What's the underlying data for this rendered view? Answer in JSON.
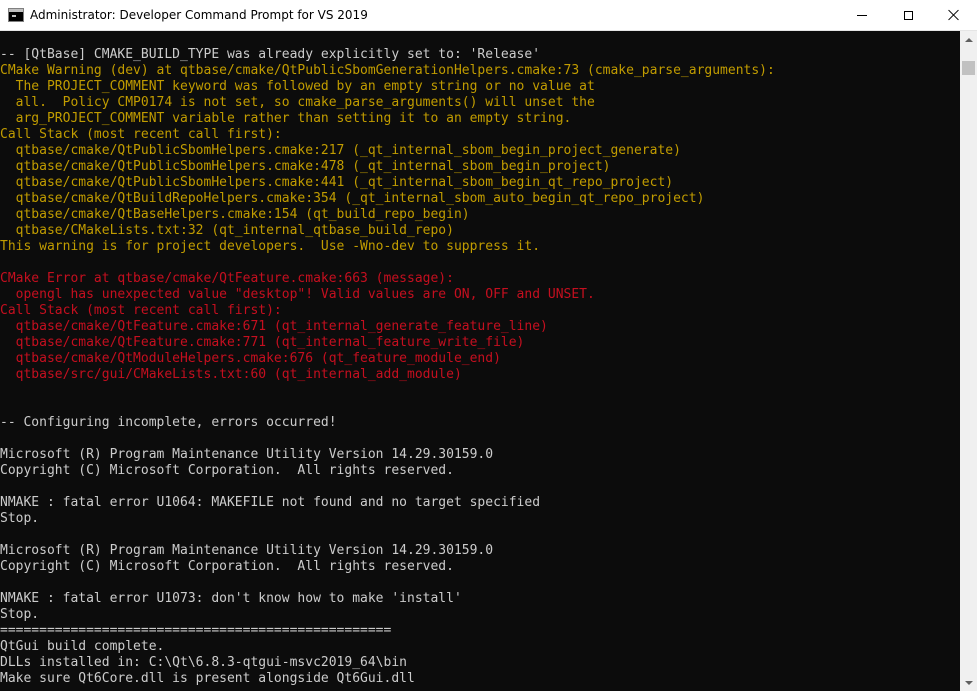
{
  "window": {
    "title": "Administrator: Developer Command Prompt for VS 2019",
    "icon": "console-icon",
    "controls": [
      "minimize-icon",
      "maximize-icon",
      "close-icon"
    ]
  },
  "colors": {
    "normal": "#cccccc",
    "warning": "#c19c00",
    "error": "#c50f1f",
    "background": "#0c0c0c"
  },
  "console": {
    "lines": [
      {
        "text": "-- [QtBase] CMAKE_BUILD_TYPE was already explicitly set to: 'Release'",
        "kind": "normal"
      },
      {
        "text": "CMake Warning (dev) at qtbase/cmake/QtPublicSbomGenerationHelpers.cmake:73 (cmake_parse_arguments):",
        "kind": "warn"
      },
      {
        "text": "  The PROJECT_COMMENT keyword was followed by an empty string or no value at",
        "kind": "warn"
      },
      {
        "text": "  all.  Policy CMP0174 is not set, so cmake_parse_arguments() will unset the",
        "kind": "warn"
      },
      {
        "text": "  arg_PROJECT_COMMENT variable rather than setting it to an empty string.",
        "kind": "warn"
      },
      {
        "text": "Call Stack (most recent call first):",
        "kind": "warn"
      },
      {
        "text": "  qtbase/cmake/QtPublicSbomHelpers.cmake:217 (_qt_internal_sbom_begin_project_generate)",
        "kind": "warn"
      },
      {
        "text": "  qtbase/cmake/QtPublicSbomHelpers.cmake:478 (_qt_internal_sbom_begin_project)",
        "kind": "warn"
      },
      {
        "text": "  qtbase/cmake/QtPublicSbomHelpers.cmake:441 (_qt_internal_sbom_begin_qt_repo_project)",
        "kind": "warn"
      },
      {
        "text": "  qtbase/cmake/QtBuildRepoHelpers.cmake:354 (_qt_internal_sbom_auto_begin_qt_repo_project)",
        "kind": "warn"
      },
      {
        "text": "  qtbase/cmake/QtBaseHelpers.cmake:154 (qt_build_repo_begin)",
        "kind": "warn"
      },
      {
        "text": "  qtbase/CMakeLists.txt:32 (qt_internal_qtbase_build_repo)",
        "kind": "warn"
      },
      {
        "text": "This warning is for project developers.  Use -Wno-dev to suppress it.",
        "kind": "warn"
      },
      {
        "text": "",
        "kind": "normal"
      },
      {
        "text": "CMake Error at qtbase/cmake/QtFeature.cmake:663 (message):",
        "kind": "error"
      },
      {
        "text": "  opengl has unexpected value \"desktop\"! Valid values are ON, OFF and UNSET.",
        "kind": "error"
      },
      {
        "text": "Call Stack (most recent call first):",
        "kind": "error"
      },
      {
        "text": "  qtbase/cmake/QtFeature.cmake:671 (qt_internal_generate_feature_line)",
        "kind": "error"
      },
      {
        "text": "  qtbase/cmake/QtFeature.cmake:771 (qt_internal_feature_write_file)",
        "kind": "error"
      },
      {
        "text": "  qtbase/cmake/QtModuleHelpers.cmake:676 (qt_feature_module_end)",
        "kind": "error"
      },
      {
        "text": "  qtbase/src/gui/CMakeLists.txt:60 (qt_internal_add_module)",
        "kind": "error"
      },
      {
        "text": "",
        "kind": "normal"
      },
      {
        "text": "",
        "kind": "normal"
      },
      {
        "text": "-- Configuring incomplete, errors occurred!",
        "kind": "normal"
      },
      {
        "text": "",
        "kind": "normal"
      },
      {
        "text": "Microsoft (R) Program Maintenance Utility Version 14.29.30159.0",
        "kind": "normal"
      },
      {
        "text": "Copyright (C) Microsoft Corporation.  All rights reserved.",
        "kind": "normal"
      },
      {
        "text": "",
        "kind": "normal"
      },
      {
        "text": "NMAKE : fatal error U1064: MAKEFILE not found and no target specified",
        "kind": "normal"
      },
      {
        "text": "Stop.",
        "kind": "normal"
      },
      {
        "text": "",
        "kind": "normal"
      },
      {
        "text": "Microsoft (R) Program Maintenance Utility Version 14.29.30159.0",
        "kind": "normal"
      },
      {
        "text": "Copyright (C) Microsoft Corporation.  All rights reserved.",
        "kind": "normal"
      },
      {
        "text": "",
        "kind": "normal"
      },
      {
        "text": "NMAKE : fatal error U1073: don't know how to make 'install'",
        "kind": "normal"
      },
      {
        "text": "Stop.",
        "kind": "normal"
      },
      {
        "text": "==================================================",
        "kind": "normal"
      },
      {
        "text": "QtGui build complete.",
        "kind": "normal"
      },
      {
        "text": "DLLs installed in: C:\\Qt\\6.8.3-qtgui-msvc2019_64\\bin",
        "kind": "normal"
      },
      {
        "text": "Make sure Qt6Core.dll is present alongside Qt6Gui.dll",
        "kind": "normal"
      }
    ]
  }
}
